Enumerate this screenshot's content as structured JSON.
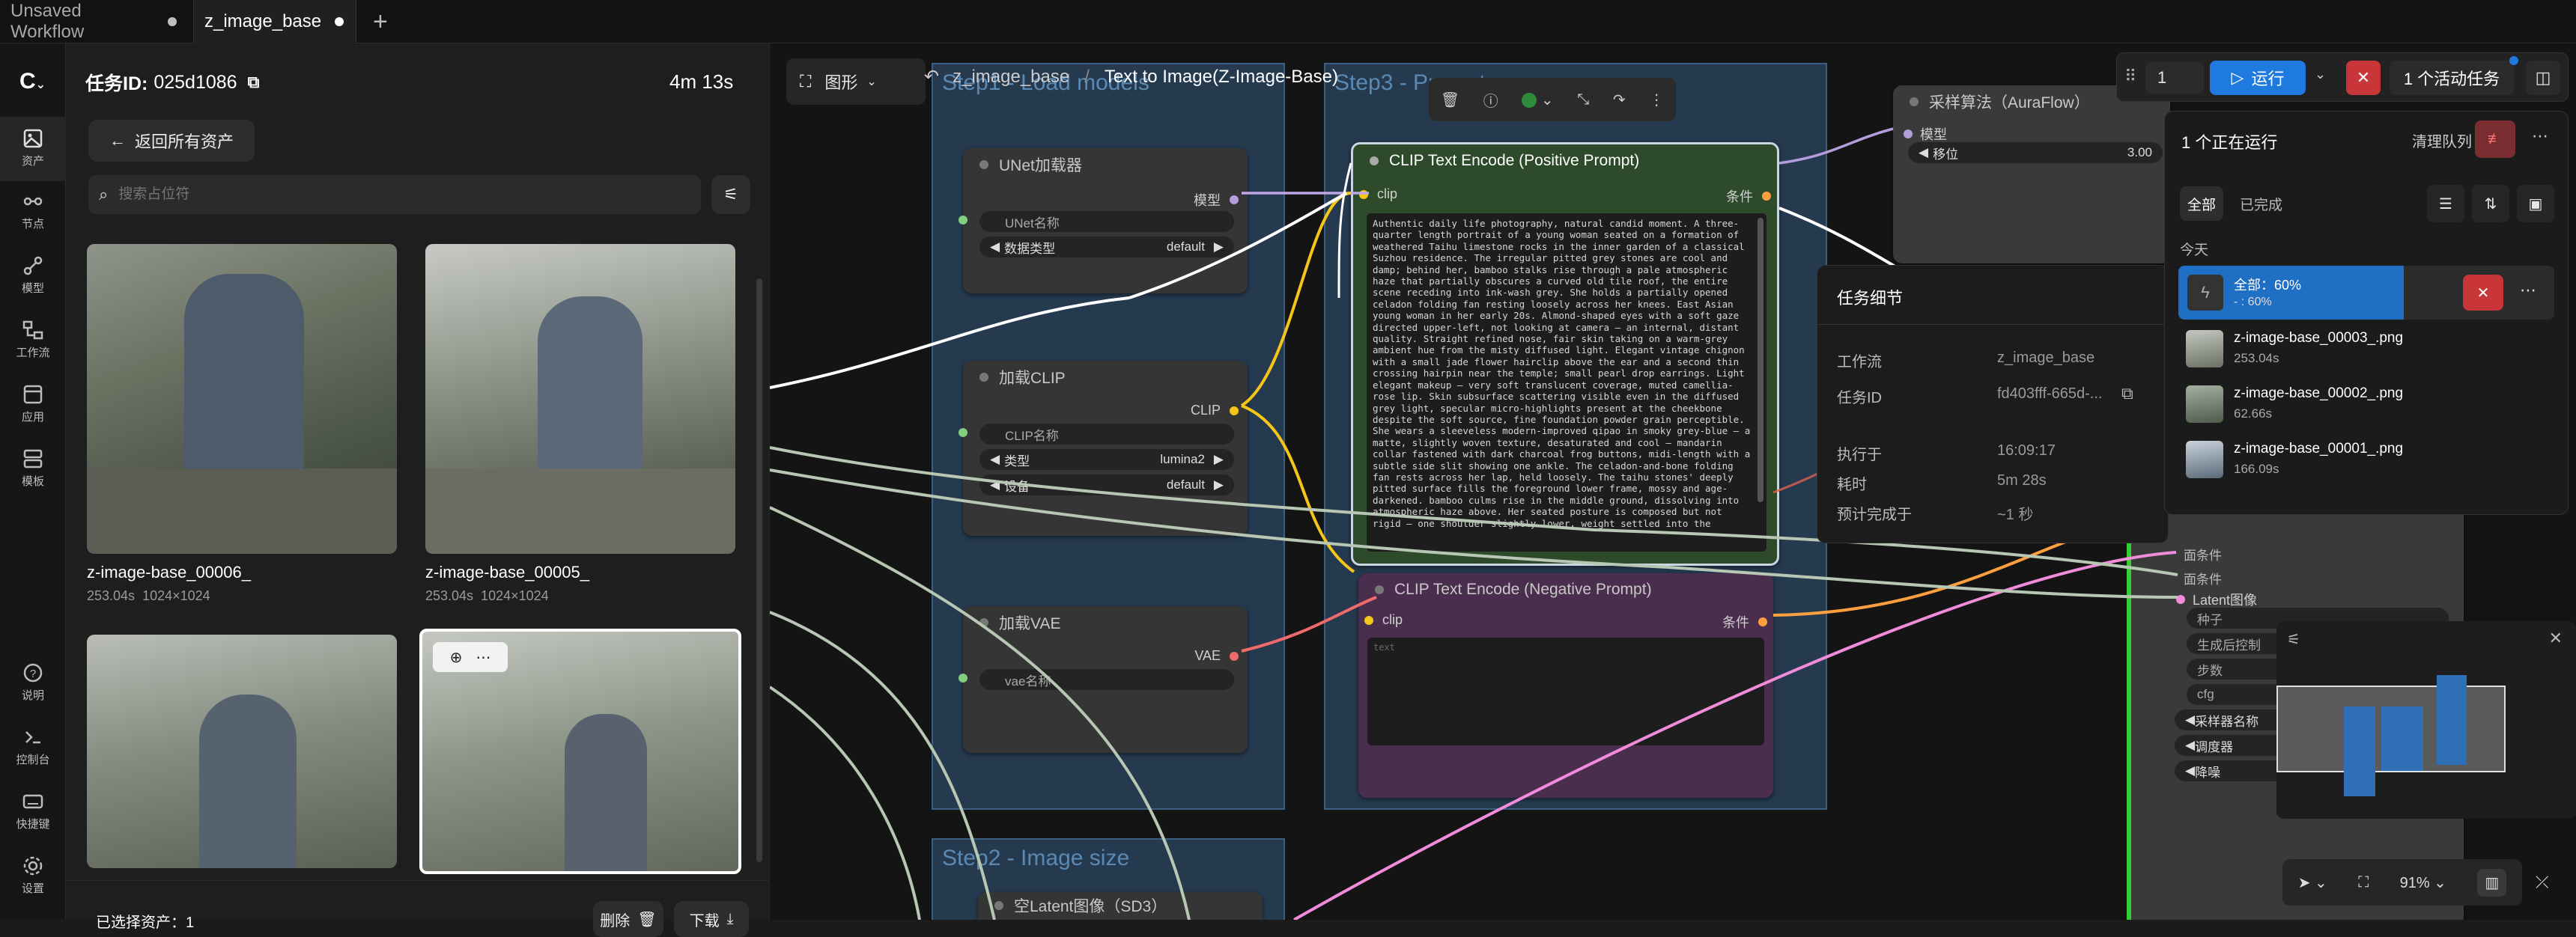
{
  "tabs": [
    {
      "label": "Unsaved Workflow"
    },
    {
      "label": "z_image_base"
    }
  ],
  "rail": {
    "items": [
      {
        "label": "资产"
      },
      {
        "label": "节点"
      },
      {
        "label": "模型"
      },
      {
        "label": "工作流"
      },
      {
        "label": "应用"
      },
      {
        "label": "模板"
      },
      {
        "label": "说明"
      },
      {
        "label": "控制台"
      },
      {
        "label": "快捷键"
      },
      {
        "label": "设置"
      }
    ]
  },
  "assets": {
    "task_label": "任务ID:",
    "task_id": "025d1086",
    "duration": "4m 13s",
    "back_label": "返回所有资产",
    "search_placeholder": "搜索占位符",
    "items": [
      {
        "name": "z-image-base_00006_",
        "meta": "253.04s  1024×1024"
      },
      {
        "name": "z-image-base_00005_",
        "meta": "253.04s  1024×1024"
      }
    ],
    "selected_label": "已选择资产：1",
    "delete_label": "删除",
    "download_label": "下载"
  },
  "canvas": {
    "view_label": "图形",
    "breadcrumb": "z_image_base",
    "workflow_title": "Text to Image(Z-Image-Base)",
    "groups": {
      "step1": "Step1 - Load models",
      "step3": "Step3 - Prompt",
      "step2": "Step2 - Image size"
    },
    "nodes": {
      "unet": {
        "title": "UNet加载器",
        "out": "模型",
        "w1": "UNet名称",
        "w2_label": "数据类型",
        "w2_value": "default"
      },
      "clip": {
        "title": "加载CLIP",
        "out": "CLIP",
        "w1": "CLIP名称",
        "w2_label": "类型",
        "w2_value": "lumina2",
        "w3_label": "设备",
        "w3_value": "default"
      },
      "vae": {
        "title": "加载VAE",
        "out": "VAE",
        "w1": "vae名称"
      },
      "pos": {
        "title": "CLIP Text Encode (Positive Prompt)",
        "in": "clip",
        "out": "条件",
        "text": "Authentic daily life photography, natural candid moment. A three-quarter length portrait of a young woman seated on a formation of weathered Taihu limestone rocks in the inner garden of a classical Suzhou residence. The irregular pitted grey stones are cool and damp; behind her, bamboo stalks rise through a pale atmospheric haze that partially obscures a curved old tile roof, the entire scene receding into ink-wash grey. She holds a partially opened celadon folding fan resting loosely across her knees. East Asian young woman in her early 20s. Almond-shaped eyes with a soft gaze directed upper-left, not looking at camera — an internal, distant quality. Straight refined nose, fair skin taking on a warm-grey ambient hue from the misty diffused light. Elegant vintage chignon with a small jade flower hairclip above the ear and a second thin crossing hairpin near the temple; small pearl drop earrings. Light elegant makeup — very soft translucent coverage, muted camellia-rose lip. Skin subsurface scattering visible even in the diffused grey light, specular micro-highlights present at the cheekbone despite the soft source, fine foundation powder grain perceptible. She wears a sleeveless modern-improved qipao in smoky grey-blue — a matte, slightly woven texture, desaturated and cool — mandarin collar fastened with dark charcoal frog buttons, midi-length with a subtle side slit showing one ankle. The celadon-and-bone folding fan rests across her lap, held loosely. The taihu stones' deeply pitted surface fills the foreground lower frame, mossy and age-darkened. bamboo culms rise in the middle ground, dissolving into atmospheric haze above. Her seated posture is composed but not rigid — one shoulder slightly lower, weight settled into the"
      },
      "neg": {
        "title": "CLIP Text Encode (Negative Prompt)",
        "in": "clip",
        "out": "条件",
        "placeholder": "text"
      },
      "sampler_algo": {
        "title": "采样算法（AuraFlow）",
        "in": "模型",
        "w_label": "移位",
        "w_value": "3.00"
      },
      "empty_latent": {
        "title": "空Latent图像（SD3）"
      }
    },
    "ksampler_slots": [
      "Latent图像",
      "种子",
      "生成后控制",
      "步数",
      "cfg",
      "采样器名称",
      "调度器",
      "降噪"
    ],
    "ksampler_partial": [
      "面条件",
      "面条件"
    ],
    "zoom": "91%"
  },
  "task_detail": {
    "title": "任务细节",
    "rows": [
      {
        "k": "工作流",
        "v": "z_image_base"
      },
      {
        "k": "任务ID",
        "v": "fd403fff-665d-..."
      },
      {
        "k": "执行于",
        "v": "16:09:17"
      },
      {
        "k": "耗时",
        "v": "5m 28s"
      },
      {
        "k": "预计完成于",
        "v": "~1 秒"
      }
    ]
  },
  "queue": {
    "run_count": "1",
    "run_label": "运行",
    "active_label": "1 个活动任务",
    "running_label": "1 个正在运行",
    "clear_label": "清理队列",
    "filter_all": "全部",
    "filter_done": "已完成",
    "today": "今天",
    "progress_title": "全部：60%",
    "progress_sub": "- : 60%",
    "progress": 0.6,
    "jobs": [
      {
        "name": "z-image-base_00003_.png",
        "time": "253.04s"
      },
      {
        "name": "z-image-base_00002_.png",
        "time": "62.66s"
      },
      {
        "name": "z-image-base_00001_.png",
        "time": "166.09s"
      }
    ]
  },
  "colors": {
    "accent": "#1f7ae0",
    "danger": "#c9363a",
    "group": "#25394f"
  }
}
